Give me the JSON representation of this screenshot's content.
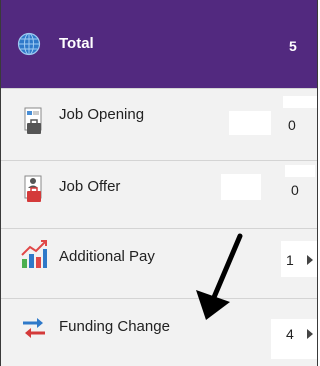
{
  "header": {
    "icon": "globe-icon",
    "title": "Total",
    "count": "5",
    "color": "#52297f"
  },
  "rows": [
    {
      "label": "Job Opening",
      "value": "0",
      "icon": "job-opening-icon"
    },
    {
      "label": "Job Offer",
      "value": "0",
      "icon": "job-offer-icon"
    },
    {
      "label": "Additional Pay",
      "value": "1",
      "icon": "bar-chart-icon",
      "chevron": true
    },
    {
      "label": "Funding Change",
      "value": "4",
      "icon": "swap-arrows-icon",
      "chevron": true
    }
  ],
  "annotation": {
    "icon": "black-arrow-icon"
  }
}
